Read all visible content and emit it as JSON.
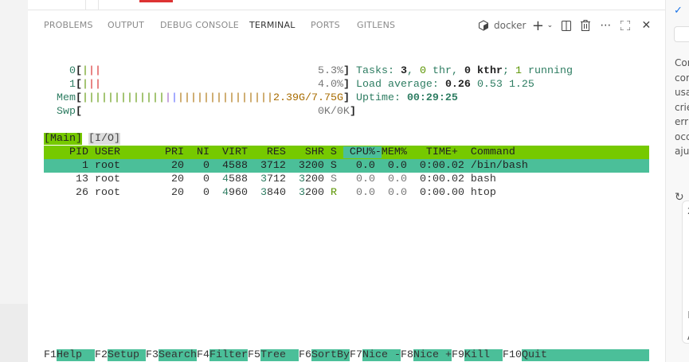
{
  "tabs": [
    {
      "label": "PROBLEMS",
      "active": false
    },
    {
      "label": "OUTPUT",
      "active": false
    },
    {
      "label": "DEBUG CONSOLE",
      "active": false
    },
    {
      "label": "TERMINAL",
      "active": true
    },
    {
      "label": "PORTS",
      "active": false
    },
    {
      "label": "GITLENS",
      "active": false
    }
  ],
  "toolbar": {
    "terminal_name": "docker",
    "icons": [
      "docker-icon",
      "plus-icon",
      "chevron-down-icon",
      "split-icon",
      "trash-icon",
      "more-icon",
      "maximize-icon",
      "close-icon"
    ]
  },
  "colors": {
    "header_bg": "#76c900",
    "selected_bg": "#4bbf99",
    "label": "#2e7d62",
    "green": "#5a9400",
    "red": "#d62020",
    "orange": "#a86c00",
    "purple": "#9a5cc4",
    "blue": "#5a64ff",
    "dim": "#777777"
  },
  "htop": {
    "lines": [
      [
        [
          "    0",
          "lbl"
        ],
        [
          "[",
          "b"
        ],
        [
          "|",
          "green"
        ],
        [
          "||",
          "red"
        ],
        [
          "                                  ",
          ""
        ],
        [
          "5.3%",
          "dim"
        ],
        [
          "]",
          "b"
        ],
        [
          " Tasks: ",
          "lbl"
        ],
        [
          "3",
          "b"
        ],
        [
          ", ",
          "lbl"
        ],
        [
          "0",
          "green"
        ],
        [
          " thr, ",
          "lbl"
        ],
        [
          "0",
          "b"
        ],
        [
          " kthr",
          "b"
        ],
        [
          "; ",
          "lbl"
        ],
        [
          "1",
          "green"
        ],
        [
          " running",
          "lbl"
        ]
      ],
      [
        [
          "    1",
          "lbl"
        ],
        [
          "[",
          "b"
        ],
        [
          "|",
          "green"
        ],
        [
          "||",
          "red"
        ],
        [
          "                                  ",
          ""
        ],
        [
          "4.0%",
          "dim"
        ],
        [
          "]",
          "b"
        ],
        [
          " Load average: ",
          "lbl"
        ],
        [
          "0.26 ",
          "b"
        ],
        [
          "0.53 ",
          "lbl"
        ],
        [
          "1.25",
          "lbl"
        ]
      ],
      [
        [
          "  Mem",
          "lbl"
        ],
        [
          "[",
          "b"
        ],
        [
          "|||||||||||||",
          "green"
        ],
        [
          "|",
          "purple"
        ],
        [
          "|",
          "blue"
        ],
        [
          "|||||||||||||||",
          "orange"
        ],
        [
          "2.39G/7.75G",
          "orange"
        ],
        [
          "]",
          "b"
        ],
        [
          " Uptime: ",
          "lbl"
        ],
        [
          "00:29:25",
          "lblb"
        ]
      ],
      [
        [
          "  Swp",
          "lbl"
        ],
        [
          "[",
          "b"
        ],
        [
          "                                     ",
          ""
        ],
        [
          "0K/0K",
          "dim"
        ],
        [
          "]",
          "b"
        ]
      ],
      [
        [
          "",
          ""
        ]
      ],
      [
        [
          "[Main]",
          "maintab"
        ],
        [
          " ",
          ""
        ],
        [
          "[I/O]",
          "iotab"
        ]
      ],
      [
        [
          "    PID USER       PRI  NI  VIRT   RES   SHR S ",
          "hdr"
        ],
        [
          " CPU%-",
          "hdrsel"
        ],
        [
          "MEM%   TIME+  Command                     ",
          "hdr"
        ]
      ],
      [
        [
          "      1 root        20   0  4588  3712  3200 S   0.0  0.0  0:00.02 /bin/bash                  ",
          "sel"
        ]
      ],
      [
        [
          "     13 root        20   0  ",
          ""
        ],
        [
          "4",
          "lbl"
        ],
        [
          "588  ",
          ""
        ],
        [
          "3",
          "lbl"
        ],
        [
          "712  ",
          ""
        ],
        [
          "3",
          "lbl"
        ],
        [
          "200 ",
          ""
        ],
        [
          "S",
          "dim"
        ],
        [
          "   ",
          ""
        ],
        [
          "0.0",
          "dim"
        ],
        [
          "  ",
          ""
        ],
        [
          "0.0",
          "dim"
        ],
        [
          "  0:00.02 bash",
          ""
        ]
      ],
      [
        [
          "     26 root        20   0  ",
          ""
        ],
        [
          "4",
          "lbl"
        ],
        [
          "960  ",
          ""
        ],
        [
          "3",
          "lbl"
        ],
        [
          "840  ",
          ""
        ],
        [
          "3",
          "lbl"
        ],
        [
          "200 ",
          ""
        ],
        [
          "R",
          "green"
        ],
        [
          "   ",
          ""
        ],
        [
          "0.0",
          "dim"
        ],
        [
          "  ",
          ""
        ],
        [
          "0.0",
          "dim"
        ],
        [
          "  0:00.00 htop",
          ""
        ]
      ]
    ],
    "footer": [
      [
        "F1",
        "Help  "
      ],
      [
        "F2",
        "Setup "
      ],
      [
        "F3",
        "Search"
      ],
      [
        "F4",
        "Filter"
      ],
      [
        "F5",
        "Tree  "
      ],
      [
        "F6",
        "SortBy"
      ],
      [
        "F7",
        "Nice -"
      ],
      [
        "F8",
        "Nice +"
      ],
      [
        "F9",
        "Kill  "
      ],
      [
        "F10",
        "Quit                "
      ]
    ]
  },
  "right_panel": {
    "lines": [
      "Cor",
      "cor",
      "usa",
      "crie",
      "err",
      "occ",
      "aju"
    ],
    "lower": [
      "2",
      "Ec",
      "A"
    ]
  }
}
